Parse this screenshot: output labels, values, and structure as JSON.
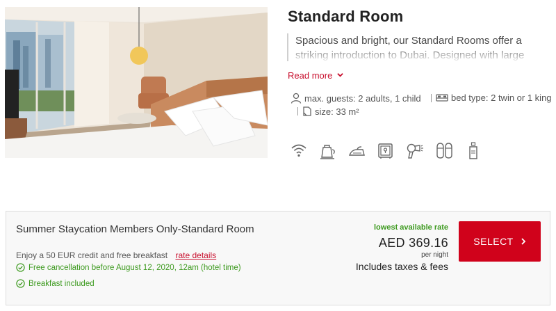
{
  "room": {
    "title": "Standard Room",
    "description": "Spacious and bright, our Standard Rooms offer a striking introduction to Dubai. Designed with large",
    "read_more": "Read more",
    "max_guests": "max. guests: 2 adults, 1 child",
    "bed_type": "bed type: 2 twin or 1 king",
    "size": "size: 33 m²"
  },
  "amenities": [
    "wifi-icon",
    "kettle-icon",
    "iron-icon",
    "safe-icon",
    "hair-dryer-icon",
    "slippers-icon",
    "toiletries-icon"
  ],
  "rate": {
    "name": "Summer Staycation Members Only-Standard Room",
    "subtitle": "Enjoy a 50 EUR credit and free breakfast",
    "rate_details": "rate details",
    "perks": [
      "Free cancellation before August 12, 2020, 12am (hotel time)",
      "Breakfast included"
    ],
    "lowest_label": "lowest available rate",
    "price": "AED 369.16",
    "per_night": "per night",
    "taxes": "Includes taxes & fees",
    "select_label": "SELECT"
  },
  "colors": {
    "accent_red": "#d0021b",
    "link_red": "#c8102e",
    "success_green": "#3d9a1f"
  }
}
